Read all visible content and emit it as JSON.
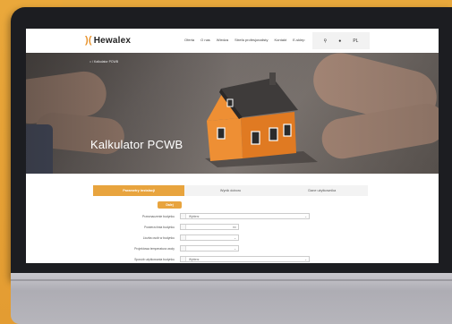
{
  "header": {
    "logo_text": "Hewalex",
    "logo_mark": ")(",
    "nav": [
      "Oferta",
      "O nas",
      "Wiedza",
      "Strefa profesjonalisty",
      "Kontakt",
      "E-sklep"
    ],
    "tools": {
      "search_glyph": "⚲",
      "user_glyph": "●",
      "language": "PL"
    }
  },
  "hero": {
    "breadcrumb": "⌂  /  Kalkulator PCWB",
    "title": "Kalkulator PCWB"
  },
  "tabs": [
    {
      "label": "Parametry instalacji",
      "active": true
    },
    {
      "label": "Wynik doboru",
      "active": false
    },
    {
      "label": "Dane użytkownika",
      "active": false
    }
  ],
  "start_button": "Dalej",
  "form": [
    {
      "label": "Przeznaczenie budynku",
      "value": "Wybierz",
      "end": "⌄"
    },
    {
      "label": "Powierzchnia budynku",
      "value": "",
      "end": "m²"
    },
    {
      "label": "Liczba osób w budynku",
      "value": "",
      "end": "⌄"
    },
    {
      "label": "Projektowa temperatura wody",
      "value": "",
      "end": "⌄"
    },
    {
      "label": "Sposób użytkowania budynku",
      "value": "Wybierz",
      "end": "⌄"
    }
  ],
  "colors": {
    "accent": "#e8a43e",
    "background": "#e8a83c",
    "monitor": "#1c1d21"
  }
}
